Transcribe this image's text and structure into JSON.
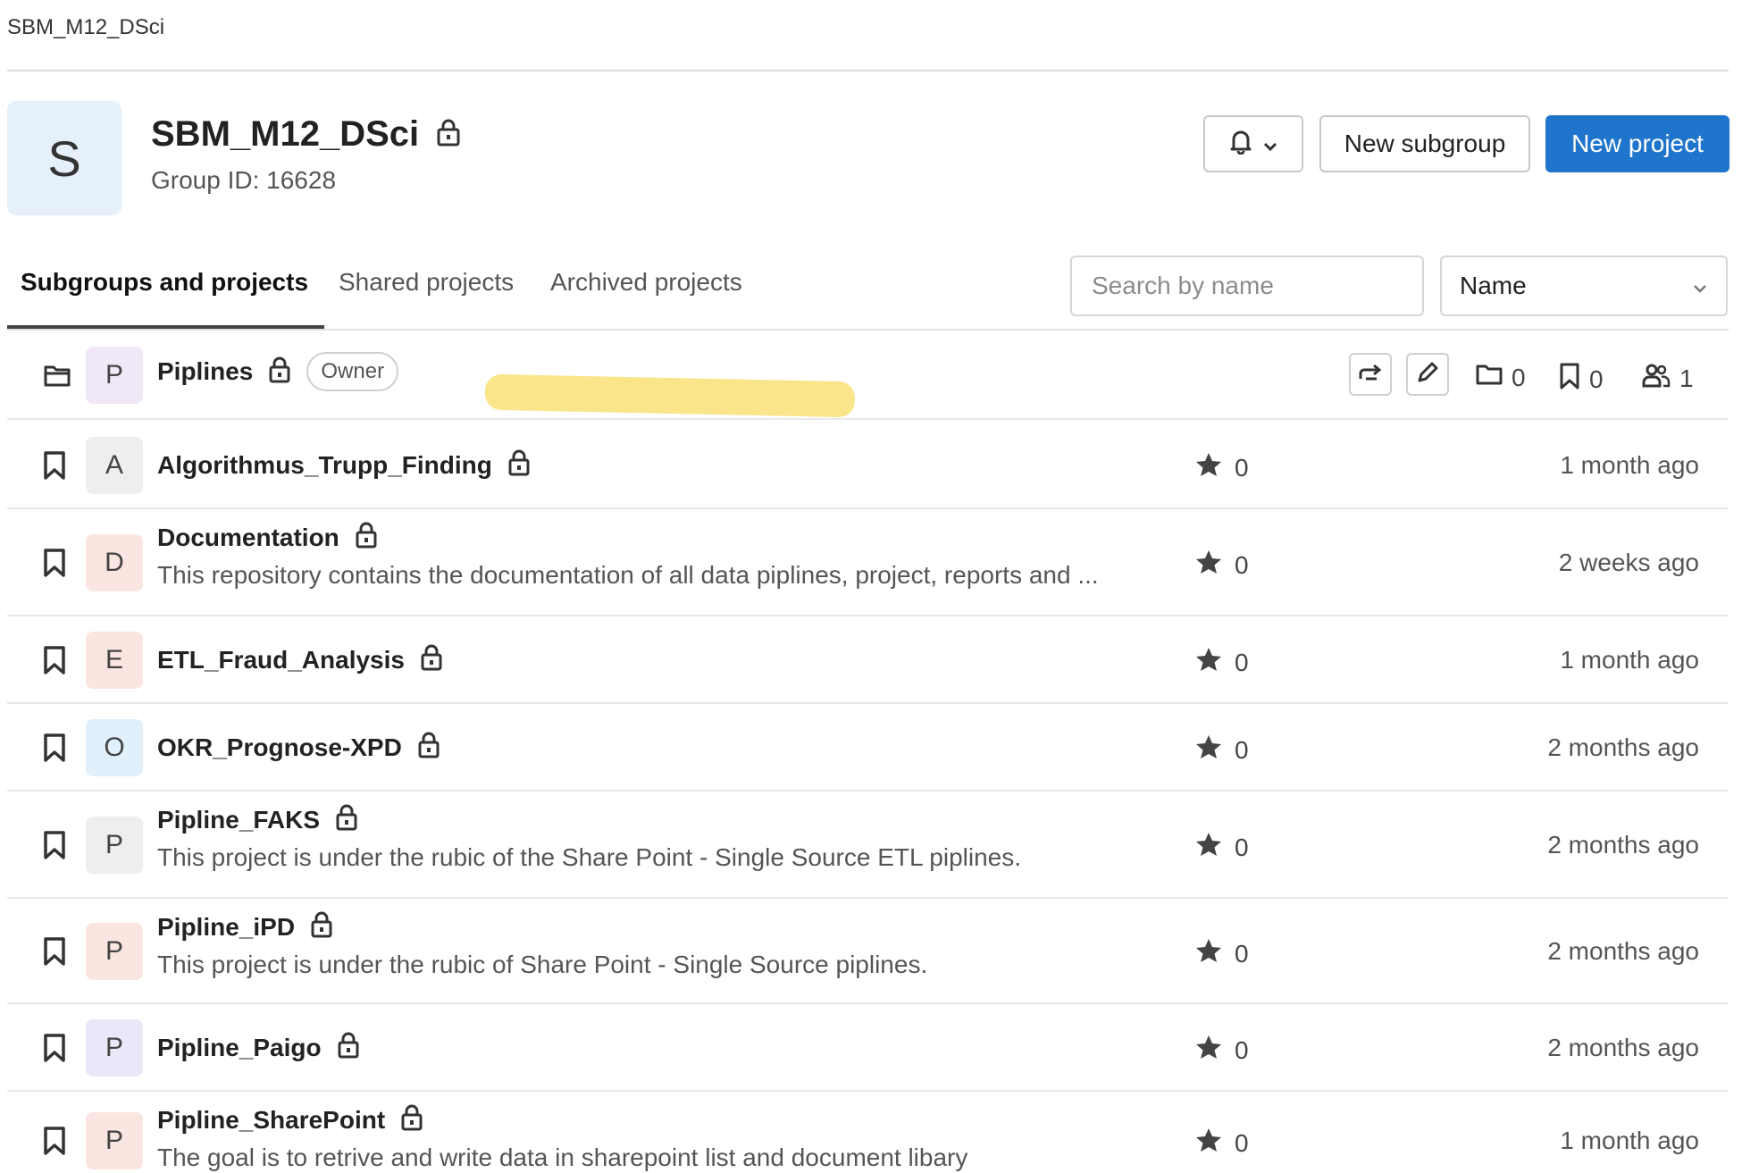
{
  "breadcrumb": "SBM_M12_DSci",
  "group": {
    "avatar_letter": "S",
    "name": "SBM_M12_DSci",
    "id_label": "Group ID: 16628"
  },
  "actions": {
    "new_subgroup": "New subgroup",
    "new_project": "New project"
  },
  "tabs": [
    {
      "label": "Subgroups and projects",
      "active": true
    },
    {
      "label": "Shared projects",
      "active": false
    },
    {
      "label": "Archived projects",
      "active": false
    }
  ],
  "search": {
    "placeholder": "Search by name"
  },
  "sort": {
    "selected": "Name"
  },
  "subgroup": {
    "avatar_letter": "P",
    "name": "Piplines",
    "badge": "Owner",
    "subgroups_count": "0",
    "projects_count": "0",
    "members_count": "1"
  },
  "projects": [
    {
      "letter": "A",
      "name": "Algorithmus_Trupp_Finding",
      "description": "",
      "stars": "0",
      "updated": "1 month ago",
      "avatar_color": "#eeeeee"
    },
    {
      "letter": "D",
      "name": "Documentation",
      "description": "This repository contains the documentation of all data piplines, project, reports and ...",
      "stars": "0",
      "updated": "2 weeks ago",
      "avatar_color": "#fbe5e1"
    },
    {
      "letter": "E",
      "name": "ETL_Fraud_Analysis",
      "description": "",
      "stars": "0",
      "updated": "1 month ago",
      "avatar_color": "#fbe5e1"
    },
    {
      "letter": "O",
      "name": "OKR_Prognose-XPD",
      "description": "",
      "stars": "0",
      "updated": "2 months ago",
      "avatar_color": "#e1f0fb"
    },
    {
      "letter": "P",
      "name": "Pipline_FAKS",
      "description": "This project is under the rubic of the Share Point - Single Source ETL piplines.",
      "stars": "0",
      "updated": "2 months ago",
      "avatar_color": "#eeeeee"
    },
    {
      "letter": "P",
      "name": "Pipline_iPD",
      "description": "This project is under the rubic of Share Point - Single Source piplines.",
      "stars": "0",
      "updated": "2 months ago",
      "avatar_color": "#fbe5e1"
    },
    {
      "letter": "P",
      "name": "Pipline_Paigo",
      "description": "",
      "stars": "0",
      "updated": "2 months ago",
      "avatar_color": "#e8e8f8"
    },
    {
      "letter": "P",
      "name": "Pipline_SharePoint",
      "description": "The goal is to retrive and write data in sharepoint list and document libary",
      "stars": "0",
      "updated": "1 month ago",
      "avatar_color": "#fbe5e1"
    }
  ]
}
